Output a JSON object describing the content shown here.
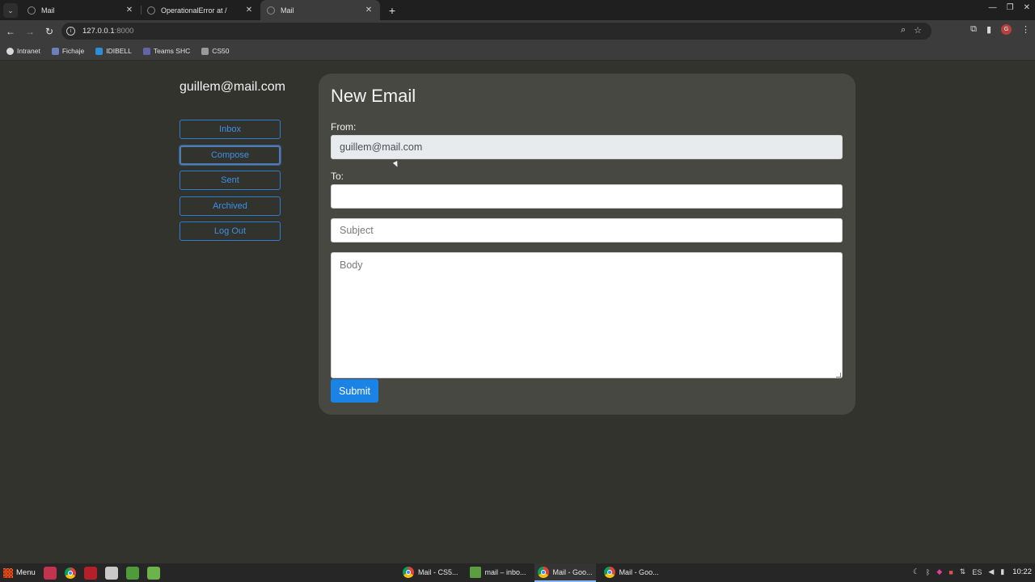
{
  "browser": {
    "tabs": [
      {
        "label": "Mail"
      },
      {
        "label": "OperationalError at /"
      },
      {
        "label": "Mail"
      }
    ],
    "url_host": "127.0.0.1",
    "url_port": ":8000",
    "bookmarks": [
      {
        "label": "Intranet"
      },
      {
        "label": "Fichaje"
      },
      {
        "label": "IDIBELL"
      },
      {
        "label": "Teams SHC"
      },
      {
        "label": "CS50"
      }
    ]
  },
  "sidebar": {
    "user_email": "guillem@mail.com",
    "nav": [
      {
        "label": "Inbox"
      },
      {
        "label": "Compose"
      },
      {
        "label": "Sent"
      },
      {
        "label": "Archived"
      },
      {
        "label": "Log Out"
      }
    ]
  },
  "compose": {
    "title": "New Email",
    "from_label": "From:",
    "from_value": "guillem@mail.com",
    "to_label": "To:",
    "to_value": "",
    "subject_placeholder": "Subject",
    "body_placeholder": "Body",
    "submit_label": "Submit"
  },
  "taskbar": {
    "menu_label": "Menu",
    "windows": [
      {
        "label": "Mail - CS5..."
      },
      {
        "label": "mail – inbo..."
      },
      {
        "label": "Mail - Goo..."
      },
      {
        "label": "Mail - Goo..."
      }
    ],
    "locale": "ES",
    "clock": "10:22"
  },
  "colors": {
    "page_bg": "#33332e",
    "card_bg": "#484843",
    "link_blue": "#3d8fe8",
    "submit_blue": "#1b82e6"
  }
}
